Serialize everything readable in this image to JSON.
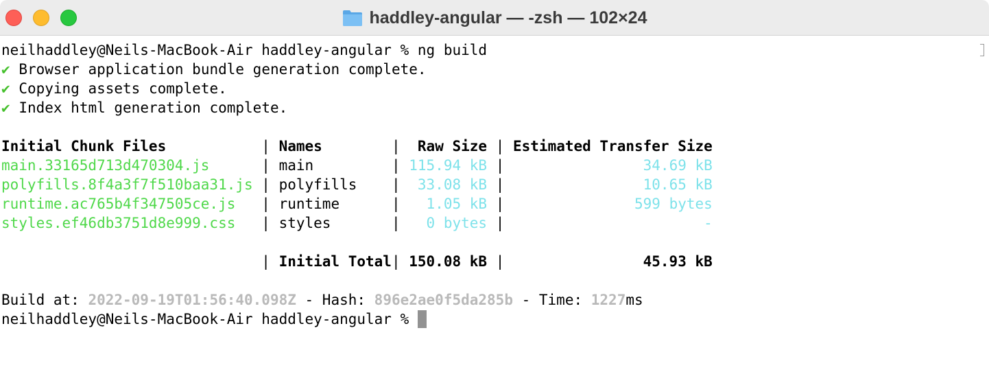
{
  "window": {
    "title": "haddley-angular — -zsh — 102×24"
  },
  "terminal": {
    "prompt": "neilhaddley@Neils-MacBook-Air haddley-angular %",
    "command": "ng build",
    "check_mark": "✔",
    "status_lines": [
      "Browser application bundle generation complete.",
      "Copying assets complete.",
      "Index html generation complete."
    ],
    "sep": "|",
    "table": {
      "headers": [
        "Initial Chunk Files",
        "Names",
        "Raw Size",
        "Estimated Transfer Size"
      ],
      "rows": [
        {
          "file": "main.33165d713d470304.js",
          "name": "main",
          "raw": "115.94 kB",
          "transfer": "34.69 kB"
        },
        {
          "file": "polyfills.8f4a3f7f510baa31.js",
          "name": "polyfills",
          "raw": "33.08 kB",
          "transfer": "10.65 kB"
        },
        {
          "file": "runtime.ac765b4f347505ce.js",
          "name": "runtime",
          "raw": "1.05 kB",
          "transfer": "599 bytes"
        },
        {
          "file": "styles.ef46db3751d8e999.css",
          "name": "styles",
          "raw": "0 bytes",
          "transfer": "-"
        }
      ],
      "total": {
        "label": "Initial Total",
        "raw": "150.08 kB",
        "transfer": "45.93 kB"
      }
    },
    "build": {
      "build_at_label": "Build at: ",
      "build_at_value": "2022-09-19T01:56:40.098Z",
      "hash_label": " - Hash: ",
      "hash_value": "896e2ae0f5da285b",
      "time_label": " - Time: ",
      "time_value": "1227",
      "time_unit": "ms"
    }
  }
}
